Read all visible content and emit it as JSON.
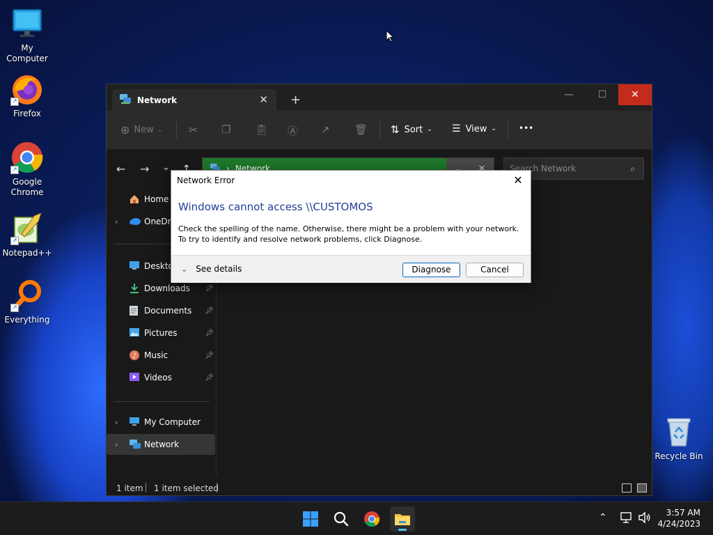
{
  "desktop": {
    "icons": [
      {
        "label": "My Computer"
      },
      {
        "label": "Firefox"
      },
      {
        "label": "Google Chrome"
      },
      {
        "label": "Notepad++"
      },
      {
        "label": "Everything"
      },
      {
        "label": "Recycle Bin"
      }
    ]
  },
  "explorer": {
    "tab_title": "Network",
    "new_tab_symbol": "+",
    "toolbar": {
      "new_label": "New",
      "sort_label": "Sort",
      "view_label": "View",
      "more_symbol": "•••"
    },
    "address": {
      "path": "Network",
      "search_placeholder": "Search Network"
    },
    "nav_items": [
      {
        "label": "Home"
      },
      {
        "label": "OneDrive"
      },
      {
        "label": "Desktop"
      },
      {
        "label": "Downloads"
      },
      {
        "label": "Documents"
      },
      {
        "label": "Pictures"
      },
      {
        "label": "Music"
      },
      {
        "label": "Videos"
      },
      {
        "label": "My Computer"
      },
      {
        "label": "Network"
      }
    ],
    "status": {
      "item_count": "1 item",
      "selected": "1 item selected"
    }
  },
  "dialog": {
    "title": "Network Error",
    "heading": "Windows cannot access \\\\CUSTOMOS",
    "message": "Check the spelling of the name. Otherwise, there might be a problem with your network. To try to identify and resolve network problems, click Diagnose.",
    "details_label": "See details",
    "diagnose_label": "Diagnose",
    "cancel_label": "Cancel"
  },
  "taskbar": {
    "time": "3:57 AM",
    "date": "4/24/2023"
  },
  "colors": {
    "accent_close": "#c42b1c",
    "address_bar": "#1f7a2a",
    "dialog_heading": "#1f3f9a",
    "taskbar_indicator": "#4cc2ff"
  }
}
